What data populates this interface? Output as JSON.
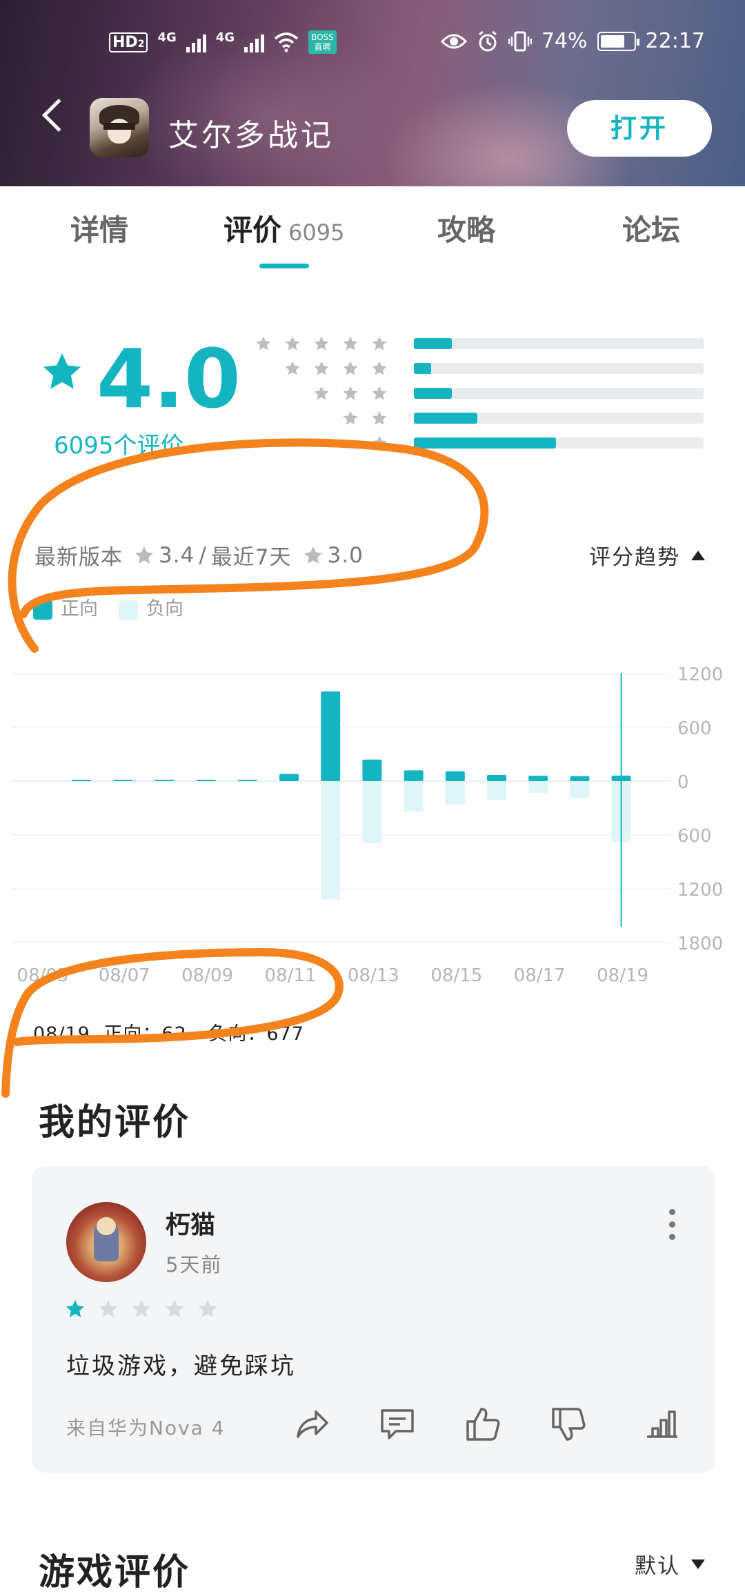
{
  "status_bar": {
    "hd": "HD",
    "hd_sub": "2",
    "network1": "4G",
    "network2": "4G",
    "boss_badge_line1": "BOSS",
    "boss_badge_line2": "直聘",
    "battery_percent": "74%",
    "battery_level": 0.74,
    "time": "22:17"
  },
  "header": {
    "app_name": "艾尔多战记",
    "open_button": "打开",
    "colors": {
      "accent": "#14b4c1"
    }
  },
  "tabs": [
    {
      "label": "详情"
    },
    {
      "label": "评价",
      "count": "6095",
      "active": true
    },
    {
      "label": "攻略"
    },
    {
      "label": "论坛"
    }
  ],
  "rating": {
    "score": "4.0",
    "count_label": "6095个评价",
    "distribution": [
      {
        "stars": 5,
        "fraction": 0.13
      },
      {
        "stars": 4,
        "fraction": 0.06
      },
      {
        "stars": 3,
        "fraction": 0.13
      },
      {
        "stars": 2,
        "fraction": 0.22
      },
      {
        "stars": 1,
        "fraction": 0.49
      }
    ],
    "latest_version_label": "最新版本",
    "latest_version_score": "3.4",
    "separator": "/",
    "recent_label": "最近7天",
    "recent_score": "3.0",
    "trend_label": "评分趋势"
  },
  "legend": {
    "positive": "正向",
    "negative": "负向"
  },
  "chart_data": {
    "type": "bar",
    "categories": [
      "08/05",
      "08/06",
      "08/07",
      "08/08",
      "08/09",
      "08/10",
      "08/11",
      "08/12",
      "08/13",
      "08/14",
      "08/15",
      "08/16",
      "08/17",
      "08/18",
      "08/19"
    ],
    "x_tick_labels": [
      "08/05",
      "08/07",
      "08/09",
      "08/11",
      "08/13",
      "08/15",
      "08/17",
      "08/19"
    ],
    "series": [
      {
        "name": "正向",
        "values": [
          0,
          0,
          0,
          0,
          0,
          10,
          80,
          1000,
          240,
          120,
          110,
          70,
          60,
          55,
          62
        ],
        "color": "#14b4c1"
      },
      {
        "name": "负向",
        "values": [
          0,
          0,
          0,
          0,
          0,
          0,
          0,
          1320,
          690,
          340,
          260,
          210,
          130,
          190,
          677
        ],
        "color": "#dff5f7"
      }
    ],
    "y_ticks_up": [
      "1200",
      "600",
      "0"
    ],
    "y_ticks_down": [
      "600",
      "1200",
      "1800"
    ],
    "ylim": [
      -1800,
      1200
    ],
    "selected": "08/19"
  },
  "day_detail": {
    "date": "08/19",
    "positive_label": "正向：",
    "positive_value": "62",
    "negative_label": "负向：",
    "negative_value": "677"
  },
  "my_review": {
    "section_title": "我的评价",
    "reviewer": "朽猫",
    "time": "5天前",
    "stars": 1,
    "text": "垃圾游戏，避免踩坑",
    "device": "来自华为Nova 4"
  },
  "game_reviews": {
    "section_title": "游戏评价",
    "sort_label": "默认"
  }
}
